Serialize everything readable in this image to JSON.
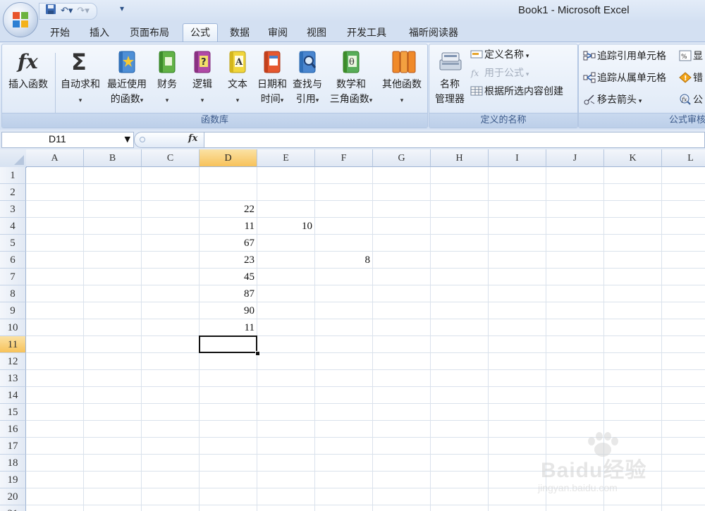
{
  "window": {
    "title": "Book1 - Microsoft Excel"
  },
  "tabs": [
    {
      "label": "开始",
      "active": false
    },
    {
      "label": "插入",
      "active": false
    },
    {
      "label": "页面布局",
      "active": false
    },
    {
      "label": "公式",
      "active": true
    },
    {
      "label": "数据",
      "active": false
    },
    {
      "label": "审阅",
      "active": false
    },
    {
      "label": "视图",
      "active": false
    },
    {
      "label": "开发工具",
      "active": false
    },
    {
      "label": "福昕阅读器",
      "active": false
    }
  ],
  "ribbon": {
    "function_library": {
      "label": "函数库",
      "insert_function": "插入函数",
      "autosum": "自动求和",
      "recent": [
        "最近使用",
        "的函数"
      ],
      "financial": "财务",
      "logical": "逻辑",
      "text": "文本",
      "datetime": [
        "日期和",
        "时间"
      ],
      "lookup": [
        "查找与",
        "引用"
      ],
      "math": [
        "数学和",
        "三角函数"
      ],
      "more": "其他函数"
    },
    "defined_names": {
      "label": "定义的名称",
      "name_manager": [
        "名称",
        "管理器"
      ],
      "define_name": "定义名称",
      "use_in_formula": "用于公式",
      "create_from_selection": "根据所选内容创建"
    },
    "formula_auditing": {
      "label": "公式审核",
      "trace_precedents": "追踪引用单元格",
      "trace_dependents": "追踪从属单元格",
      "remove_arrows": "移去箭头",
      "show_formulas": "显",
      "error_checking": "错",
      "evaluate": "公"
    }
  },
  "formula_bar": {
    "name_box": "D11",
    "fx": "fx",
    "formula": ""
  },
  "grid": {
    "columns": [
      "A",
      "B",
      "C",
      "D",
      "E",
      "F",
      "G",
      "H",
      "I",
      "J",
      "K",
      "L"
    ],
    "rows": [
      "1",
      "2",
      "3",
      "4",
      "5",
      "6",
      "7",
      "8",
      "9",
      "10",
      "11",
      "12",
      "13",
      "14",
      "15",
      "16",
      "17",
      "18",
      "19",
      "20",
      "21"
    ],
    "selected_col": "D",
    "selected_row": "11",
    "cells": [
      {
        "ref": "D3",
        "value": "22"
      },
      {
        "ref": "D4",
        "value": "11"
      },
      {
        "ref": "E4",
        "value": "10"
      },
      {
        "ref": "D5",
        "value": "67"
      },
      {
        "ref": "D6",
        "value": "23"
      },
      {
        "ref": "F6",
        "value": "8"
      },
      {
        "ref": "D7",
        "value": "45"
      },
      {
        "ref": "D8",
        "value": "87"
      },
      {
        "ref": "D9",
        "value": "90"
      },
      {
        "ref": "D10",
        "value": "11"
      }
    ]
  },
  "watermark": {
    "text": "Baidu经验",
    "sub": "jingyan.baidu.com"
  }
}
